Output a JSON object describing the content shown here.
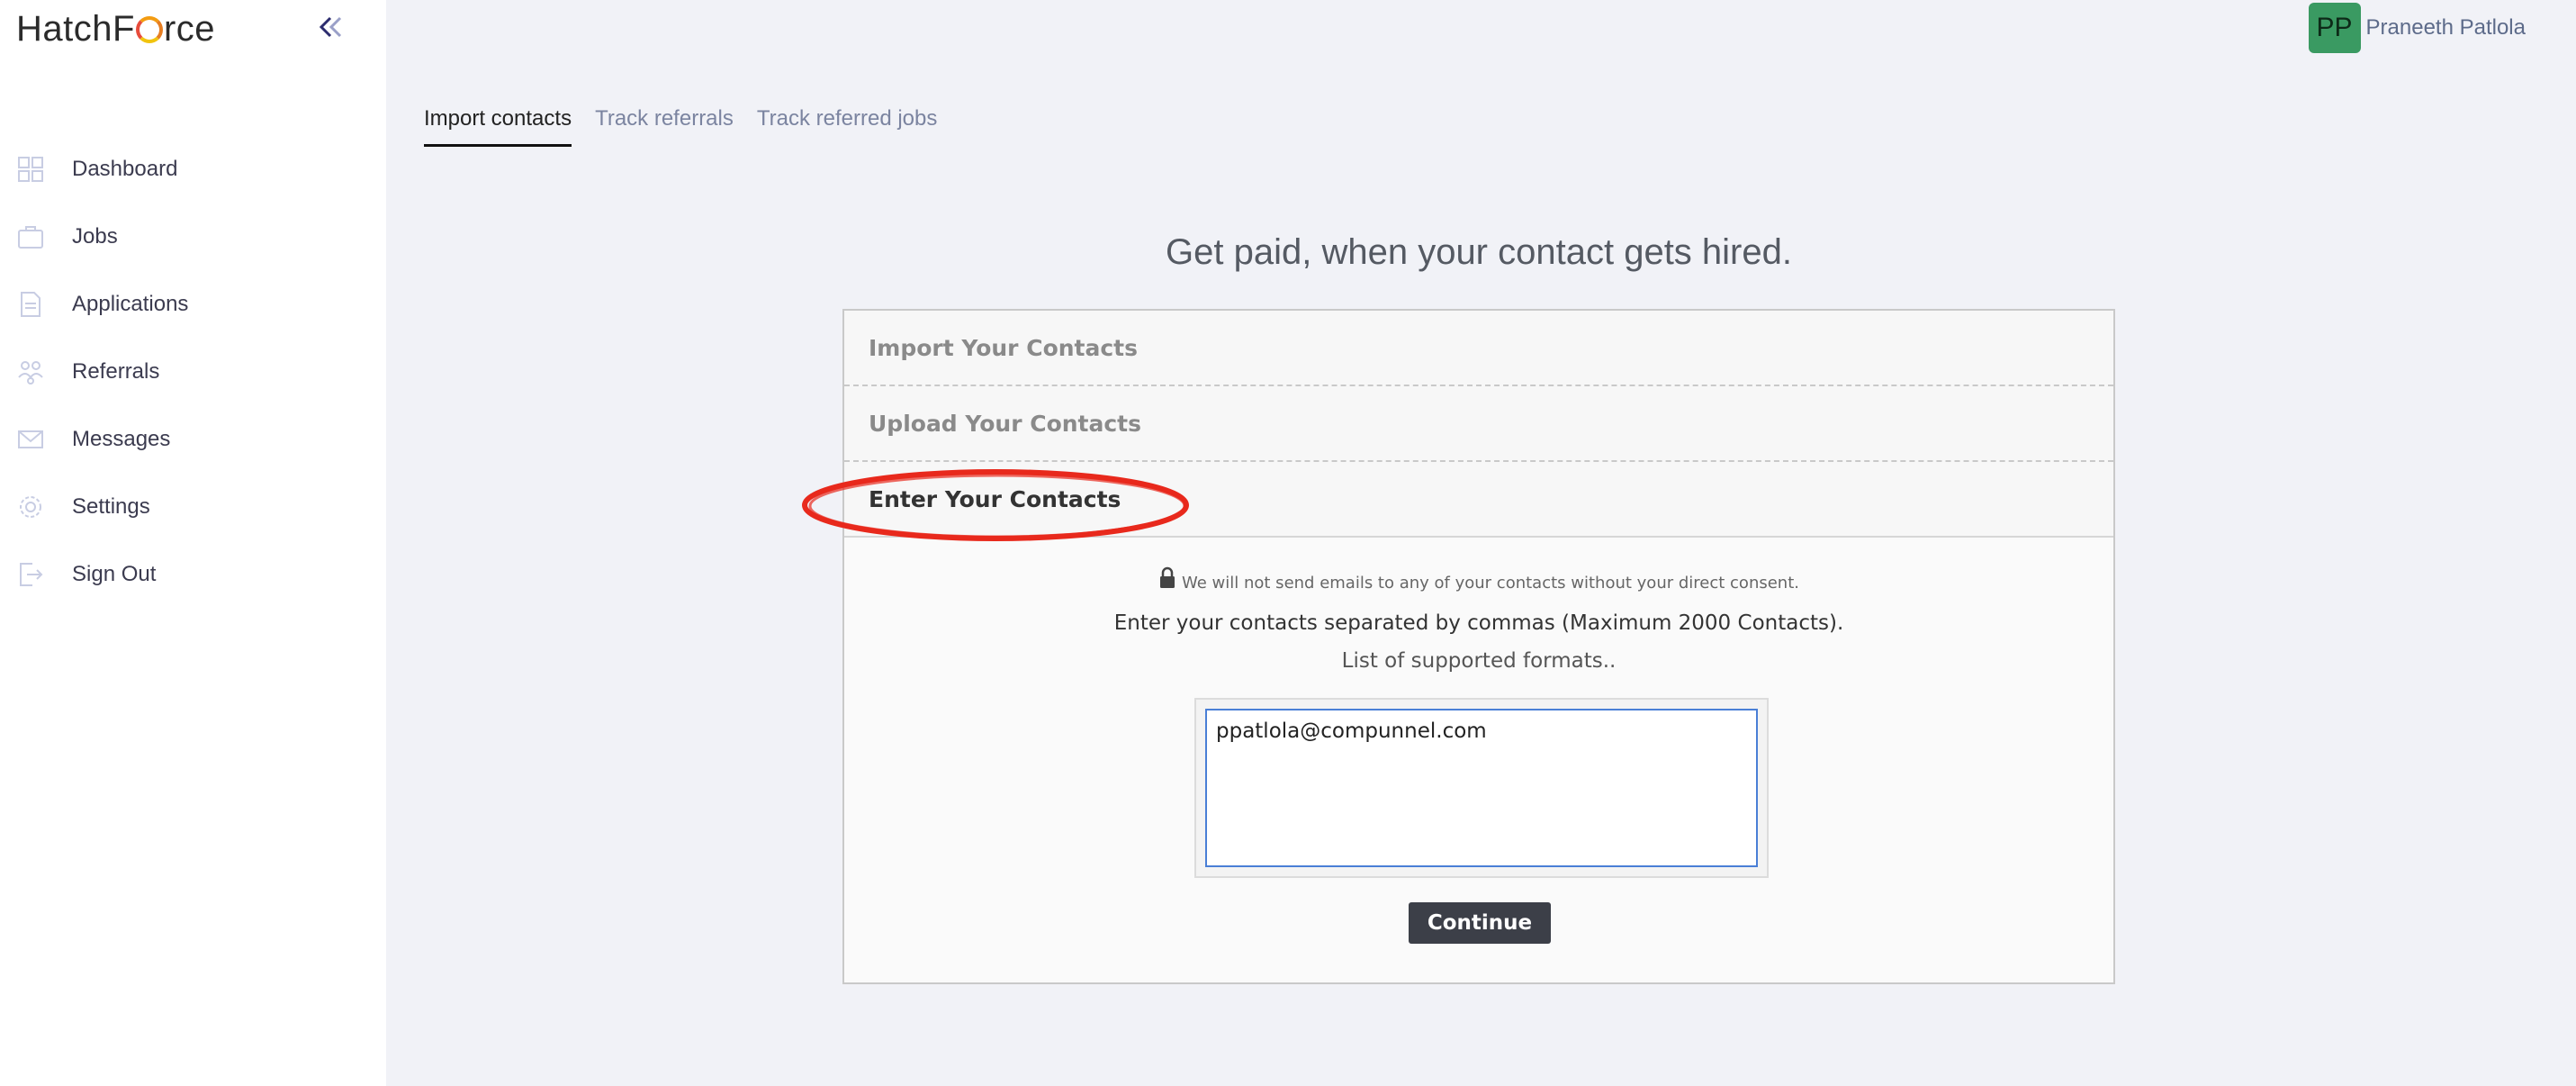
{
  "brand": {
    "logo_prefix": "HatchF",
    "logo_suffix": "rce"
  },
  "sidebar": {
    "items": [
      {
        "label": "Dashboard",
        "icon": "dashboard-icon"
      },
      {
        "label": "Jobs",
        "icon": "briefcase-icon"
      },
      {
        "label": "Applications",
        "icon": "document-icon"
      },
      {
        "label": "Referrals",
        "icon": "referrals-icon"
      },
      {
        "label": "Messages",
        "icon": "envelope-icon"
      },
      {
        "label": "Settings",
        "icon": "gear-icon"
      },
      {
        "label": "Sign Out",
        "icon": "sign-out-icon"
      }
    ]
  },
  "user": {
    "initials": "PP",
    "name": "Praneeth Patlola",
    "avatar_color": "#3a9a62"
  },
  "tabs": [
    {
      "label": "Import contacts",
      "active": true
    },
    {
      "label": "Track referrals",
      "active": false
    },
    {
      "label": "Track referred jobs",
      "active": false
    }
  ],
  "main": {
    "headline": "Get paid, when your contact gets hired.",
    "sections": [
      {
        "title": "Import Your Contacts"
      },
      {
        "title": "Upload Your Contacts"
      },
      {
        "title": "Enter Your Contacts"
      }
    ],
    "consent_text": "We will not send emails to any of your contacts without your direct consent.",
    "instructions": "Enter your contacts separated by commas (Maximum 2000 Contacts).",
    "formats_link": "List of supported formats..",
    "contacts_value": "ppatlola@compunnel.com",
    "continue_label": "Continue"
  },
  "colors": {
    "accent_blue": "#4a7fd6",
    "annotation_red": "#e8291c",
    "button_dark": "#3c3f48"
  }
}
